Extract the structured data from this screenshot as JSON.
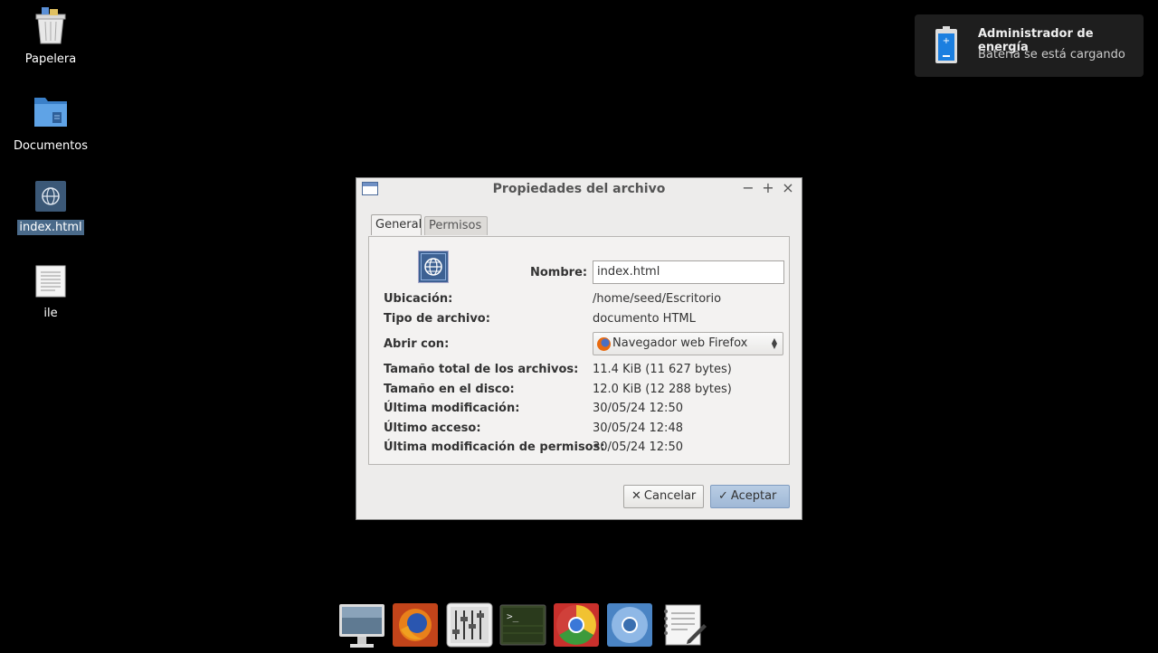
{
  "desktop": {
    "icons": [
      {
        "label": "Papelera"
      },
      {
        "label": "Documentos"
      },
      {
        "label": "index.html"
      },
      {
        "label": "ile"
      }
    ]
  },
  "notification": {
    "title": "Administrador de energía",
    "message": "Batería se está cargando"
  },
  "dialog": {
    "title": "Propiedades del archivo",
    "controls": {
      "minimize": "−",
      "maximize": "+",
      "close": "×"
    },
    "tabs": [
      {
        "label": "General"
      },
      {
        "label": "Permisos"
      }
    ],
    "name_label": "Nombre:",
    "name_value": "index.html",
    "location_label": "Ubicación:",
    "location_value": "/home/seed/Escritorio",
    "type_label": "Tipo de archivo:",
    "type_value": "documento HTML",
    "open_with_label": "Abrir con:",
    "open_with_value": "Navegador web Firefox",
    "total_size_label": "Tamaño total de los archivos:",
    "total_size_value": "11.4 KiB (11 627 bytes)",
    "disk_size_label": "Tamaño en el disco:",
    "disk_size_value": "12.0 KiB (12 288 bytes)",
    "modified_label": "Última modificación:",
    "modified_value": "30/05/24 12:50",
    "accessed_label": "Último acceso:",
    "accessed_value": "30/05/24 12:48",
    "perm_modified_label": "Última modificación de permisos:",
    "perm_modified_value": "30/05/24 12:50",
    "cancel_label": "Cancelar",
    "ok_label": "Aceptar",
    "cancel_glyph": "✕",
    "ok_glyph": "✓"
  },
  "dock": {
    "items": [
      {
        "icon": "monitor-icon"
      },
      {
        "icon": "firefox-icon"
      },
      {
        "icon": "mixer-settings-icon"
      },
      {
        "icon": "terminal-icon"
      },
      {
        "icon": "chrome-icon"
      },
      {
        "icon": "chromium-icon"
      },
      {
        "icon": "text-editor-icon"
      }
    ]
  },
  "colors": {
    "dialog_bg": "#edeceb",
    "accent": "#9fb8d6",
    "selection": "#4a6a8a"
  }
}
